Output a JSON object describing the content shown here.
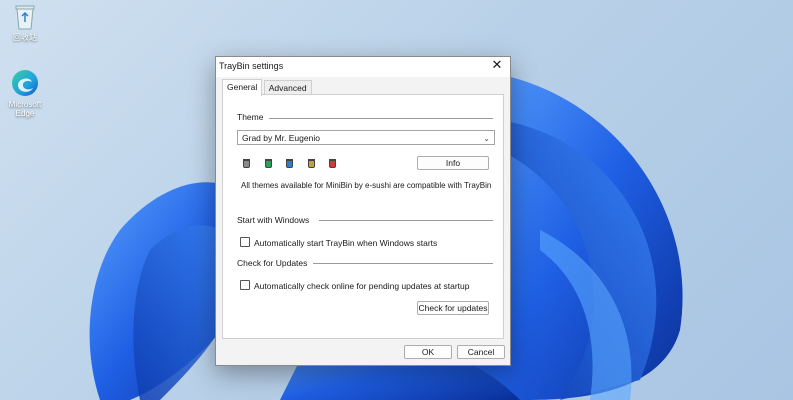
{
  "desktop": {
    "icons": [
      {
        "label": "回收站",
        "icon": "recycle-bin-icon"
      },
      {
        "label": "Microsoft Edge",
        "icon": "edge-icon"
      }
    ]
  },
  "dialog": {
    "title": "TrayBin settings",
    "close_glyph": "✕",
    "tabs": [
      {
        "label": "General",
        "active": true
      },
      {
        "label": "Advanced",
        "active": false
      }
    ],
    "theme": {
      "section_label": "Theme",
      "selected": "Grad by Mr. Eugenio",
      "info_button": "Info",
      "bin_colors": [
        "#8a8a8a",
        "#2e9f5a",
        "#2f7fc8",
        "#c4a23a",
        "#c8403a"
      ],
      "note": "All themes available for MiniBin by e-sushi are compatible with TrayBin"
    },
    "startup": {
      "section_label": "Start with Windows",
      "checkbox_label": "Automatically start TrayBin when Windows starts",
      "checked": false
    },
    "updates": {
      "section_label": "Check for Updates",
      "checkbox_label": "Automatically check online for pending updates at startup",
      "checked": false,
      "check_button": "Check for updates"
    },
    "ok_button": "OK",
    "cancel_button": "Cancel"
  },
  "colors": {
    "wallpaper_bloom": "#1a5fe0",
    "wallpaper_bloom_dark": "#0b3aa8",
    "wallpaper_bloom_light": "#4a8ff5"
  }
}
